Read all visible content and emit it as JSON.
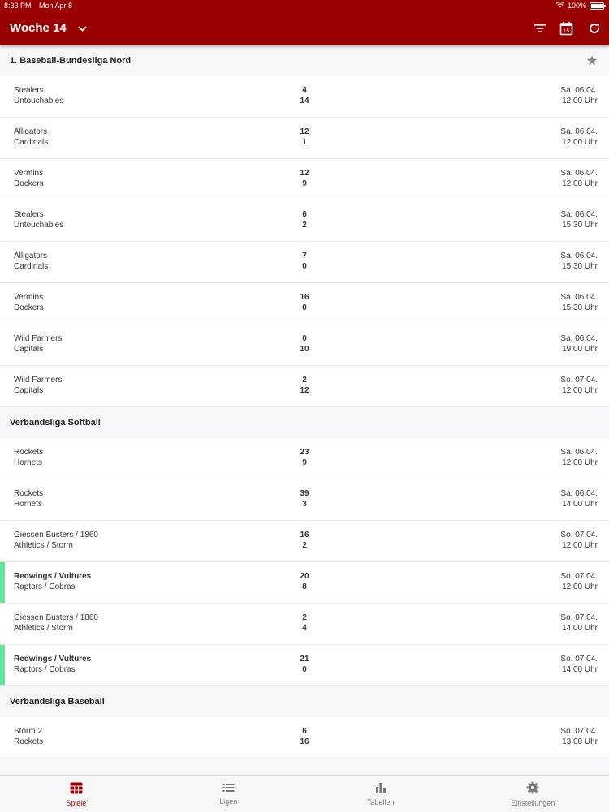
{
  "status_bar": {
    "time": "8:33 PM",
    "date": "Mon Apr 8",
    "battery": "100%"
  },
  "header": {
    "title": "Woche 14"
  },
  "sections": [
    {
      "title": "1. Baseball-Bundesliga Nord",
      "favorite": true,
      "games": [
        {
          "home": "Stealers",
          "away": "Untouchables",
          "home_score": "4",
          "away_score": "14",
          "date": "Sa. 06.04.",
          "time": "12:00 Uhr",
          "highlight": false
        },
        {
          "home": "Alligators",
          "away": "Cardinals",
          "home_score": "12",
          "away_score": "1",
          "date": "Sa. 06.04.",
          "time": "12:00 Uhr",
          "highlight": false
        },
        {
          "home": "Vermins",
          "away": "Dockers",
          "home_score": "12",
          "away_score": "9",
          "date": "Sa. 06.04.",
          "time": "12:00 Uhr",
          "highlight": false
        },
        {
          "home": "Stealers",
          "away": "Untouchables",
          "home_score": "6",
          "away_score": "2",
          "date": "Sa. 06.04.",
          "time": "15:30 Uhr",
          "highlight": false
        },
        {
          "home": "Alligators",
          "away": "Cardinals",
          "home_score": "7",
          "away_score": "0",
          "date": "Sa. 06.04.",
          "time": "15:30 Uhr",
          "highlight": false
        },
        {
          "home": "Vermins",
          "away": "Dockers",
          "home_score": "16",
          "away_score": "0",
          "date": "Sa. 06.04.",
          "time": "15:30 Uhr",
          "highlight": false
        },
        {
          "home": "Wild Farmers",
          "away": "Capitals",
          "home_score": "0",
          "away_score": "10",
          "date": "Sa. 06.04.",
          "time": "19:00 Uhr",
          "highlight": false
        },
        {
          "home": "Wild Farmers",
          "away": "Capitals",
          "home_score": "2",
          "away_score": "12",
          "date": "So. 07.04.",
          "time": "12:00 Uhr",
          "highlight": false
        }
      ]
    },
    {
      "title": "Verbandsliga Softball",
      "favorite": false,
      "games": [
        {
          "home": "Rockets",
          "away": "Hornets",
          "home_score": "23",
          "away_score": "9",
          "date": "Sa. 06.04.",
          "time": "12:00 Uhr",
          "highlight": false
        },
        {
          "home": "Rockets",
          "away": "Hornets",
          "home_score": "39",
          "away_score": "3",
          "date": "Sa. 06.04.",
          "time": "14:00 Uhr",
          "highlight": false
        },
        {
          "home": "Giessen Busters / 1860",
          "away": "Athletics / Storm",
          "home_score": "16",
          "away_score": "2",
          "date": "So. 07.04.",
          "time": "12:00 Uhr",
          "highlight": false
        },
        {
          "home": "Redwings / Vultures",
          "away": "Raptors / Cobras",
          "home_score": "20",
          "away_score": "8",
          "date": "So. 07.04.",
          "time": "12:00 Uhr",
          "highlight": true
        },
        {
          "home": "Giessen Busters / 1860",
          "away": "Athletics / Storm",
          "home_score": "2",
          "away_score": "4",
          "date": "So. 07.04.",
          "time": "14:00 Uhr",
          "highlight": false
        },
        {
          "home": "Redwings / Vultures",
          "away": "Raptors / Cobras",
          "home_score": "21",
          "away_score": "0",
          "date": "So. 07.04.",
          "time": "14:00 Uhr",
          "highlight": true
        }
      ]
    },
    {
      "title": "Verbandsliga Baseball",
      "favorite": false,
      "games": [
        {
          "home": "Storm 2",
          "away": "Rockets",
          "home_score": "6",
          "away_score": "16",
          "date": "So. 07.04.",
          "time": "13:00 Uhr",
          "highlight": false
        }
      ]
    }
  ],
  "tabs": [
    {
      "label": "Spiele",
      "icon": "calendar-grid-icon",
      "active": true
    },
    {
      "label": "Ligen",
      "icon": "list-icon",
      "active": false
    },
    {
      "label": "Tabellen",
      "icon": "bar-chart-icon",
      "active": false
    },
    {
      "label": "Einstellungen",
      "icon": "gear-icon",
      "active": false
    }
  ],
  "colors": {
    "primary": "#990000",
    "highlight": "#5fe69a"
  }
}
